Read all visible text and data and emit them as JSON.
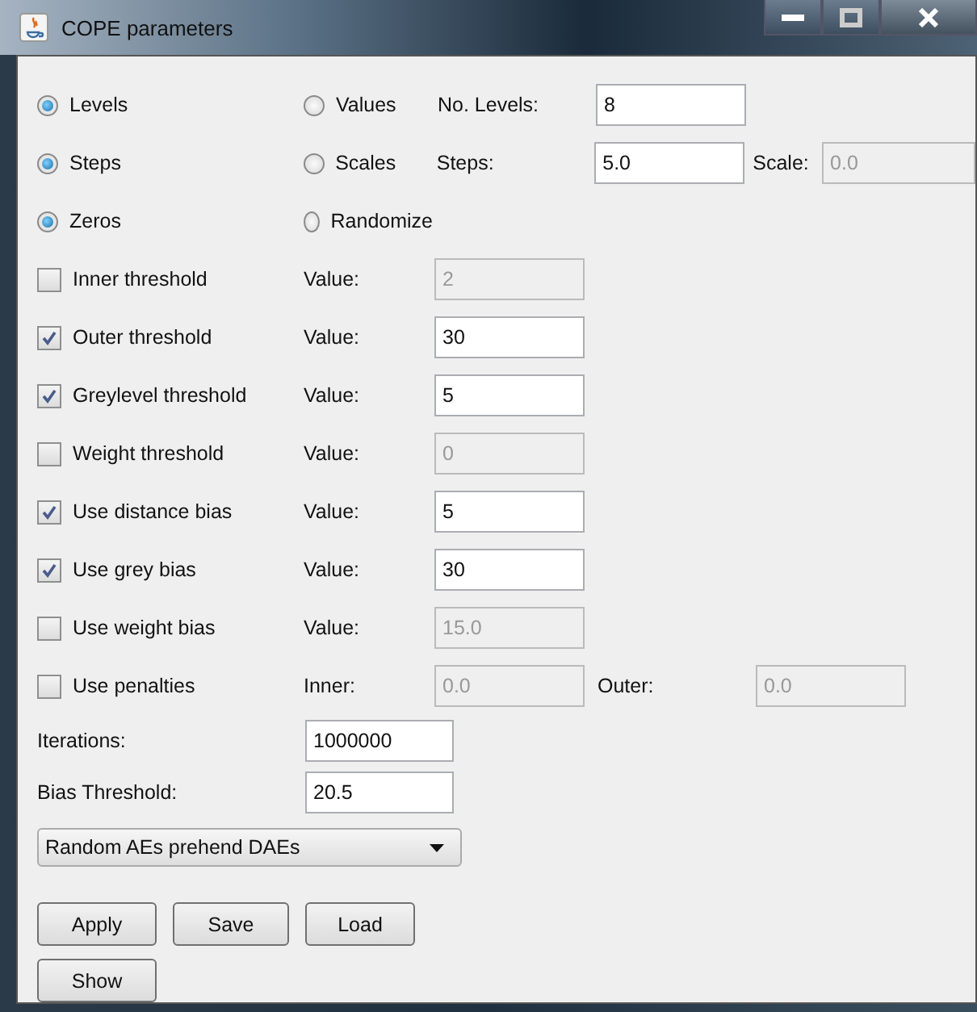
{
  "window": {
    "title": "COPE parameters"
  },
  "radio_rows": [
    {
      "left": {
        "label": "Levels",
        "selected": true
      },
      "right": {
        "label": "Values",
        "selected": false
      },
      "field_label": "No. Levels:",
      "field": {
        "value": "8",
        "disabled": false
      }
    },
    {
      "left": {
        "label": "Steps",
        "selected": true
      },
      "right": {
        "label": "Scales",
        "selected": false
      },
      "field_label": "Steps:",
      "field": {
        "value": "5.0",
        "disabled": false
      },
      "extra_label": "Scale:",
      "extra_field": {
        "value": "0.0",
        "disabled": true
      }
    },
    {
      "left": {
        "label": "Zeros",
        "selected": true
      },
      "right": {
        "label": "Randomize",
        "selected": false
      }
    }
  ],
  "check_rows": [
    {
      "label": "Inner threshold",
      "checked": false,
      "field_label": "Value:",
      "field": {
        "value": "2",
        "disabled": true
      }
    },
    {
      "label": "Outer threshold",
      "checked": true,
      "field_label": "Value:",
      "field": {
        "value": "30",
        "disabled": false
      }
    },
    {
      "label": "Greylevel threshold",
      "checked": true,
      "field_label": "Value:",
      "field": {
        "value": "5",
        "disabled": false
      }
    },
    {
      "label": "Weight threshold",
      "checked": false,
      "field_label": "Value:",
      "field": {
        "value": "0",
        "disabled": true
      }
    },
    {
      "label": "Use distance bias",
      "checked": true,
      "field_label": "Value:",
      "field": {
        "value": "5",
        "disabled": false
      }
    },
    {
      "label": "Use grey bias",
      "checked": true,
      "field_label": "Value:",
      "field": {
        "value": "30",
        "disabled": false
      }
    },
    {
      "label": "Use weight bias",
      "checked": false,
      "field_label": "Value:",
      "field": {
        "value": "15.0",
        "disabled": true
      }
    },
    {
      "label": "Use penalties",
      "checked": false,
      "field_label": "Inner:",
      "field": {
        "value": "0.0",
        "disabled": true
      },
      "extra_label": "Outer:",
      "extra_field": {
        "value": "0.0",
        "disabled": true
      }
    }
  ],
  "params": [
    {
      "label": "Iterations:",
      "value": "1000000"
    },
    {
      "label": "Bias Threshold:",
      "value": "20.5"
    }
  ],
  "dropdown": {
    "value": "Random AEs prehend DAEs"
  },
  "button_rows": [
    [
      "Apply",
      "Save",
      "Load"
    ],
    [
      "Show"
    ]
  ]
}
